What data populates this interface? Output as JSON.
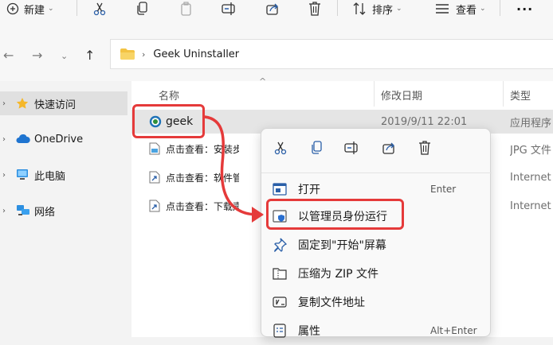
{
  "toolbar": {
    "new_label": "新建",
    "sort_label": "排序",
    "view_label": "查看",
    "more_label": "···"
  },
  "address": {
    "path": "Geek Uninstaller"
  },
  "nav": {
    "items": [
      {
        "label": "快速访问",
        "icon": "star-icon"
      },
      {
        "label": "OneDrive",
        "icon": "cloud-icon"
      },
      {
        "label": "此电脑",
        "icon": "computer-icon"
      },
      {
        "label": "网络",
        "icon": "network-icon"
      }
    ]
  },
  "list": {
    "columns": {
      "name": "名称",
      "date": "修改日期",
      "type": "类型"
    },
    "rows": [
      {
        "name": "geek",
        "date": "2019/9/11 22:01",
        "type": "应用程序"
      },
      {
        "name": "点击查看：安装步骤",
        "date": "",
        "type": "JPG 文件"
      },
      {
        "name": "点击查看：软件管家",
        "date": "",
        "type": "Internet"
      },
      {
        "name": "点击查看：下载声明",
        "date": "",
        "type": "Internet"
      }
    ]
  },
  "context_menu": {
    "items": [
      {
        "label": "打开",
        "shortcut": "Enter"
      },
      {
        "label": "以管理员身份运行",
        "shortcut": ""
      },
      {
        "label": "固定到\"开始\"屏幕",
        "shortcut": ""
      },
      {
        "label": "压缩为 ZIP 文件",
        "shortcut": ""
      },
      {
        "label": "复制文件地址",
        "shortcut": ""
      },
      {
        "label": "属性",
        "shortcut": "Alt+Enter"
      }
    ]
  },
  "colors": {
    "highlight": "#e53a3a",
    "accent": "#0067c0",
    "folder": "#f3c343"
  }
}
